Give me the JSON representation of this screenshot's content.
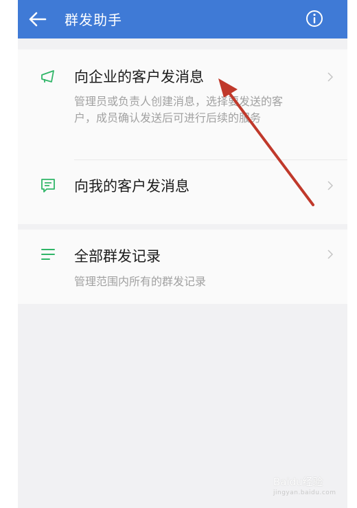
{
  "header": {
    "title": "群发助手",
    "back_icon": "arrow-left-icon",
    "info_icon": "info-circle-icon",
    "bg_color": "#3f7ad6"
  },
  "menu": {
    "enterprise": {
      "title": "向企业的客户发消息",
      "description": "管理员或负责人创建消息，选择要发送的客户，成员确认发送后可进行后续的服务",
      "icon": "megaphone-icon"
    },
    "mine": {
      "title": "向我的客户发消息",
      "icon": "chat-bubble-icon"
    },
    "records": {
      "title": "全部群发记录",
      "description": "管理范围内所有的群发记录",
      "icon": "list-icon"
    }
  },
  "accent_color": "#2fb567",
  "annotation_color": "#c0392b",
  "watermark": {
    "text": "Baidu经验",
    "sub": "jingyan.baidu.com"
  }
}
